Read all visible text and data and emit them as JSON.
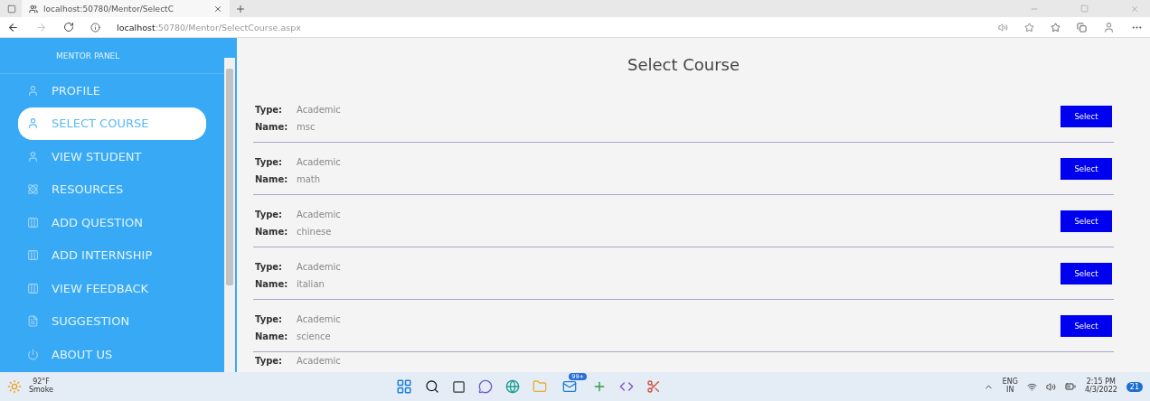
{
  "browser": {
    "tab_title": "localhost:50780/Mentor/SelectC",
    "url_host": "localhost",
    "url_rest": ":50780/Mentor/SelectCourse.aspx"
  },
  "sidebar": {
    "title": "MENTOR PANEL",
    "items": [
      {
        "label": "PROFILE",
        "selected": false
      },
      {
        "label": "SELECT COURSE",
        "selected": true
      },
      {
        "label": "VIEW STUDENT",
        "selected": false
      },
      {
        "label": "RESOURCES",
        "selected": false
      },
      {
        "label": "ADD QUESTION",
        "selected": false
      },
      {
        "label": "ADD INTERNSHIP",
        "selected": false
      },
      {
        "label": "VIEW FEEDBACK",
        "selected": false
      },
      {
        "label": "SUGGESTION",
        "selected": false
      },
      {
        "label": "ABOUT US",
        "selected": false
      }
    ]
  },
  "page": {
    "title": "Select Course",
    "courses": [
      {
        "type_label": "Type:",
        "type": "Academic",
        "name_label": "Name:",
        "name": "msc",
        "button": "Select"
      },
      {
        "type_label": "Type:",
        "type": "Academic",
        "name_label": "Name:",
        "name": "math",
        "button": "Select"
      },
      {
        "type_label": "Type:",
        "type": "Academic",
        "name_label": "Name:",
        "name": "chinese",
        "button": "Select"
      },
      {
        "type_label": "Type:",
        "type": "Academic",
        "name_label": "Name:",
        "name": "italian",
        "button": "Select"
      },
      {
        "type_label": "Type:",
        "type": "Academic",
        "name_label": "Name:",
        "name": "science",
        "button": "Select"
      },
      {
        "type_label": "Type:",
        "type": "Academic"
      }
    ]
  },
  "taskbar": {
    "temperature": "92°F",
    "weather": "Smoke",
    "mail_badge": "99+",
    "language": "ENG",
    "region": "IN",
    "time": "2:15 PM",
    "date": "4/3/2022",
    "notification_count": "21"
  }
}
